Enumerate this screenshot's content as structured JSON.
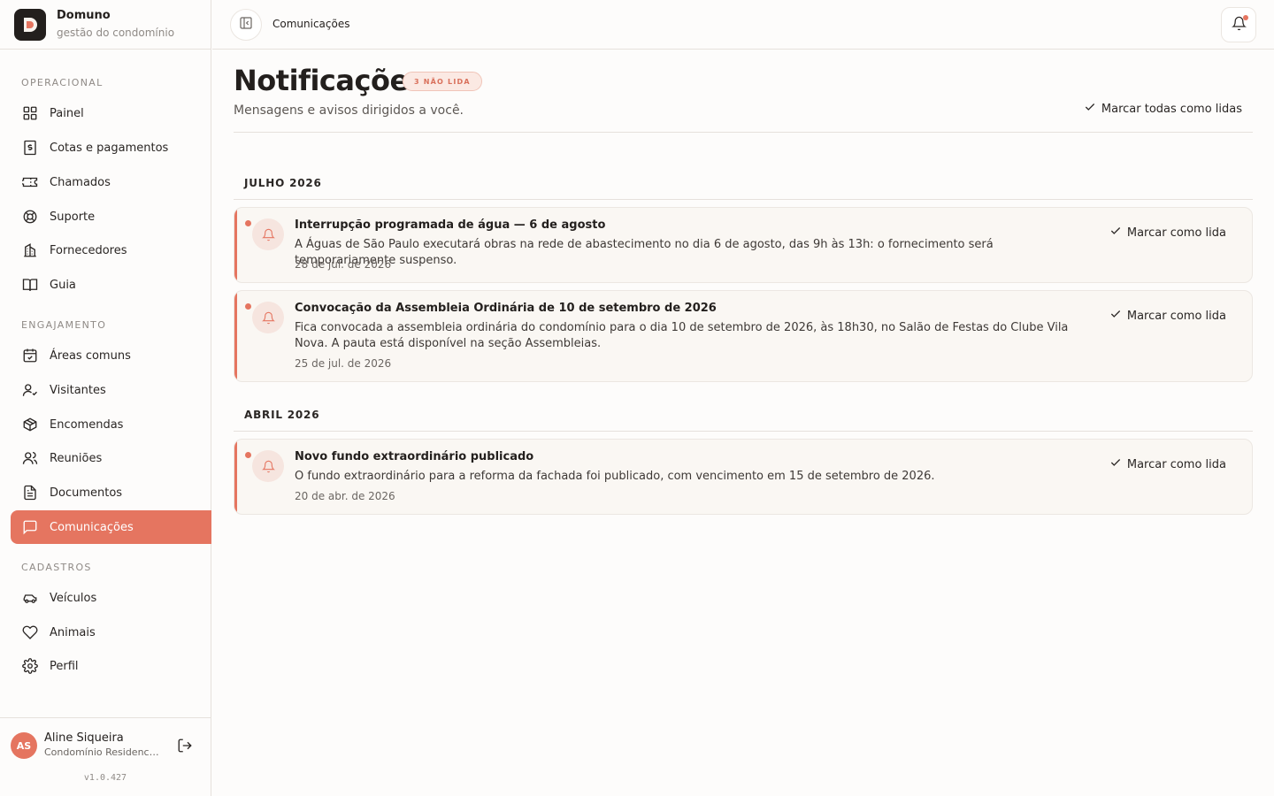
{
  "brand": {
    "name": "Domuno",
    "subtitle": "gestão do condomínio"
  },
  "sidebar": {
    "sections": [
      {
        "label": "OPERACIONAL"
      },
      {
        "label": "ENGAJAMENTO"
      },
      {
        "label": "CADASTROS"
      }
    ],
    "items": [
      {
        "label": "Painel",
        "icon": "grid-icon"
      },
      {
        "label": "Cotas e pagamentos",
        "icon": "receipt-dollar-icon"
      },
      {
        "label": "Chamados",
        "icon": "ticket-icon"
      },
      {
        "label": "Suporte",
        "icon": "lifebuoy-icon"
      },
      {
        "label": "Fornecedores",
        "icon": "building-icon"
      },
      {
        "label": "Guia",
        "icon": "book-icon"
      },
      {
        "label": "Áreas comuns",
        "icon": "calendar-check-icon"
      },
      {
        "label": "Visitantes",
        "icon": "user-check-icon"
      },
      {
        "label": "Encomendas",
        "icon": "package-icon"
      },
      {
        "label": "Reuniões",
        "icon": "users-icon"
      },
      {
        "label": "Documentos",
        "icon": "document-icon"
      },
      {
        "label": "Comunicações",
        "icon": "message-icon",
        "active": true
      },
      {
        "label": "Veículos",
        "icon": "car-icon"
      },
      {
        "label": "Animais",
        "icon": "heart-icon"
      },
      {
        "label": "Perfil",
        "icon": "gear-icon"
      }
    ]
  },
  "user": {
    "initials": "AS",
    "name": "Aline Siqueira",
    "condo": "Condomínio Residencial ...",
    "version": "v1.0.427"
  },
  "topbar": {
    "breadcrumb": "Comunicações"
  },
  "header": {
    "title": "Notificações",
    "badge": "3 NÃO LIDA",
    "subtitle": "Mensagens e avisos dirigidos a você.",
    "mark_all": "Marcar todas como lidas"
  },
  "groups": [
    {
      "month": "JULHO 2026",
      "items": [
        {
          "title": "Interrupção programada de água — 6 de agosto",
          "body": "A Águas de São Paulo executará obras na rede de abastecimento no dia 6 de agosto, das 9h às 13h: o fornecimento será temporariamente suspenso.",
          "date": "28 de jul. de 2026",
          "action": "Marcar como lida"
        },
        {
          "title": "Convocação da Assembleia Ordinária de 10 de setembro de 2026",
          "body": "Fica convocada a assembleia ordinária do condomínio para o dia 10 de setembro de 2026, às 18h30, no Salão de Festas do Clube Vila Nova. A pauta está disponível na seção Assembleias.",
          "date": "25 de jul. de 2026",
          "action": "Marcar como lida"
        }
      ]
    },
    {
      "month": "ABRIL 2026",
      "items": [
        {
          "title": "Novo fundo extraordinário publicado",
          "body": "O fundo extraordinário para a reforma da fachada foi publicado, com vencimento em 15 de setembro de 2026.",
          "date": "20 de abr. de 2026",
          "action": "Marcar como lida"
        }
      ]
    }
  ],
  "colors": {
    "accent": "#e57560",
    "background": "#fdfcfb",
    "card": "#faf7f3"
  }
}
